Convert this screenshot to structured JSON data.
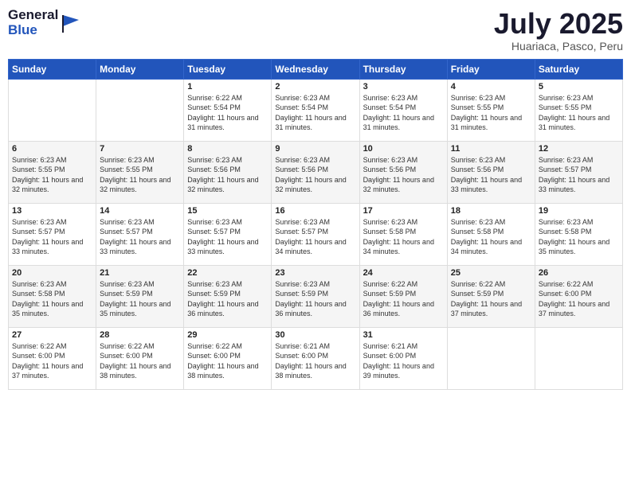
{
  "header": {
    "logo": {
      "general": "General",
      "blue": "Blue"
    },
    "title": "July 2025",
    "location": "Huariaca, Pasco, Peru"
  },
  "weekdays": [
    "Sunday",
    "Monday",
    "Tuesday",
    "Wednesday",
    "Thursday",
    "Friday",
    "Saturday"
  ],
  "weeks": [
    [
      {
        "day": "",
        "info": ""
      },
      {
        "day": "",
        "info": ""
      },
      {
        "day": "1",
        "sunrise": "6:22 AM",
        "sunset": "5:54 PM",
        "daylight": "11 hours and 31 minutes."
      },
      {
        "day": "2",
        "sunrise": "6:23 AM",
        "sunset": "5:54 PM",
        "daylight": "11 hours and 31 minutes."
      },
      {
        "day": "3",
        "sunrise": "6:23 AM",
        "sunset": "5:54 PM",
        "daylight": "11 hours and 31 minutes."
      },
      {
        "day": "4",
        "sunrise": "6:23 AM",
        "sunset": "5:55 PM",
        "daylight": "11 hours and 31 minutes."
      },
      {
        "day": "5",
        "sunrise": "6:23 AM",
        "sunset": "5:55 PM",
        "daylight": "11 hours and 31 minutes."
      }
    ],
    [
      {
        "day": "6",
        "sunrise": "6:23 AM",
        "sunset": "5:55 PM",
        "daylight": "11 hours and 32 minutes."
      },
      {
        "day": "7",
        "sunrise": "6:23 AM",
        "sunset": "5:55 PM",
        "daylight": "11 hours and 32 minutes."
      },
      {
        "day": "8",
        "sunrise": "6:23 AM",
        "sunset": "5:56 PM",
        "daylight": "11 hours and 32 minutes."
      },
      {
        "day": "9",
        "sunrise": "6:23 AM",
        "sunset": "5:56 PM",
        "daylight": "11 hours and 32 minutes."
      },
      {
        "day": "10",
        "sunrise": "6:23 AM",
        "sunset": "5:56 PM",
        "daylight": "11 hours and 32 minutes."
      },
      {
        "day": "11",
        "sunrise": "6:23 AM",
        "sunset": "5:56 PM",
        "daylight": "11 hours and 33 minutes."
      },
      {
        "day": "12",
        "sunrise": "6:23 AM",
        "sunset": "5:57 PM",
        "daylight": "11 hours and 33 minutes."
      }
    ],
    [
      {
        "day": "13",
        "sunrise": "6:23 AM",
        "sunset": "5:57 PM",
        "daylight": "11 hours and 33 minutes."
      },
      {
        "day": "14",
        "sunrise": "6:23 AM",
        "sunset": "5:57 PM",
        "daylight": "11 hours and 33 minutes."
      },
      {
        "day": "15",
        "sunrise": "6:23 AM",
        "sunset": "5:57 PM",
        "daylight": "11 hours and 33 minutes."
      },
      {
        "day": "16",
        "sunrise": "6:23 AM",
        "sunset": "5:57 PM",
        "daylight": "11 hours and 34 minutes."
      },
      {
        "day": "17",
        "sunrise": "6:23 AM",
        "sunset": "5:58 PM",
        "daylight": "11 hours and 34 minutes."
      },
      {
        "day": "18",
        "sunrise": "6:23 AM",
        "sunset": "5:58 PM",
        "daylight": "11 hours and 34 minutes."
      },
      {
        "day": "19",
        "sunrise": "6:23 AM",
        "sunset": "5:58 PM",
        "daylight": "11 hours and 35 minutes."
      }
    ],
    [
      {
        "day": "20",
        "sunrise": "6:23 AM",
        "sunset": "5:58 PM",
        "daylight": "11 hours and 35 minutes."
      },
      {
        "day": "21",
        "sunrise": "6:23 AM",
        "sunset": "5:59 PM",
        "daylight": "11 hours and 35 minutes."
      },
      {
        "day": "22",
        "sunrise": "6:23 AM",
        "sunset": "5:59 PM",
        "daylight": "11 hours and 36 minutes."
      },
      {
        "day": "23",
        "sunrise": "6:23 AM",
        "sunset": "5:59 PM",
        "daylight": "11 hours and 36 minutes."
      },
      {
        "day": "24",
        "sunrise": "6:22 AM",
        "sunset": "5:59 PM",
        "daylight": "11 hours and 36 minutes."
      },
      {
        "day": "25",
        "sunrise": "6:22 AM",
        "sunset": "5:59 PM",
        "daylight": "11 hours and 37 minutes."
      },
      {
        "day": "26",
        "sunrise": "6:22 AM",
        "sunset": "6:00 PM",
        "daylight": "11 hours and 37 minutes."
      }
    ],
    [
      {
        "day": "27",
        "sunrise": "6:22 AM",
        "sunset": "6:00 PM",
        "daylight": "11 hours and 37 minutes."
      },
      {
        "day": "28",
        "sunrise": "6:22 AM",
        "sunset": "6:00 PM",
        "daylight": "11 hours and 38 minutes."
      },
      {
        "day": "29",
        "sunrise": "6:22 AM",
        "sunset": "6:00 PM",
        "daylight": "11 hours and 38 minutes."
      },
      {
        "day": "30",
        "sunrise": "6:21 AM",
        "sunset": "6:00 PM",
        "daylight": "11 hours and 38 minutes."
      },
      {
        "day": "31",
        "sunrise": "6:21 AM",
        "sunset": "6:00 PM",
        "daylight": "11 hours and 39 minutes."
      },
      {
        "day": "",
        "info": ""
      },
      {
        "day": "",
        "info": ""
      }
    ]
  ],
  "labels": {
    "sunrise": "Sunrise:",
    "sunset": "Sunset:",
    "daylight": "Daylight:"
  }
}
